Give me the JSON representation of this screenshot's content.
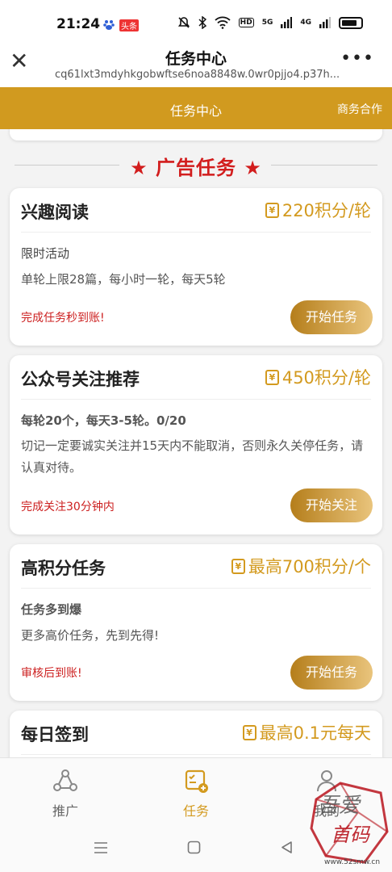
{
  "status": {
    "time": "21:24",
    "badge": "头条",
    "hd": "HD",
    "net1": "5G",
    "net2": "4G"
  },
  "browser": {
    "title": "任务中心",
    "url": "cq61lxt3mdyhkgobwftse6noa8848w.0wr0pjjo4.p37h..."
  },
  "header": {
    "title": "任务中心",
    "right_link": "商务合作"
  },
  "section": {
    "title": "★ 广告任务 ★"
  },
  "coin_glyph": "¥",
  "cards": [
    {
      "title": "兴趣阅读",
      "points": "220积分/轮",
      "sub": "限时活动",
      "desc": "单轮上限28篇，每小时一轮，每天5轮",
      "note": "完成任务秒到账!",
      "button": "开始任务"
    },
    {
      "title": "公众号关注推荐",
      "points": "450积分/轮",
      "sub": "每轮20个，每天3-5轮。0/20",
      "desc": "切记一定要诚实关注并15天内不能取消，否则永久关停任务，请认真对待。",
      "note": "完成关注30分钟内",
      "button": "开始关注"
    },
    {
      "title": "高积分任务",
      "points": "最高700积分/个",
      "sub": "任务多到爆",
      "desc": "更多高价任务，先到先得!",
      "note": "审核后到账!",
      "button": "开始任务"
    },
    {
      "title": "每日签到",
      "points": "最高0.1元每天"
    }
  ],
  "tabs": [
    {
      "label": "推广",
      "icon": "share-icon"
    },
    {
      "label": "任务",
      "icon": "task-icon"
    },
    {
      "label": "我的",
      "icon": "person-icon"
    }
  ],
  "watermark": {
    "line1": "吾爱",
    "line2": "首码",
    "site": "www.52smw.cn"
  },
  "colors": {
    "gold": "#d19a1f",
    "red": "#d21d1d",
    "active_tab": "#d39a1f"
  }
}
